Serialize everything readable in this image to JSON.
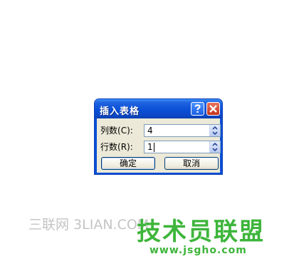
{
  "dialog": {
    "title": "插入表格",
    "help_button": "?",
    "columns_label": "列数",
    "columns_hotkey": "(C):",
    "columns_value": "4",
    "rows_label": "行数",
    "rows_hotkey": "(R):",
    "rows_value": "1",
    "ok_label": "确定",
    "cancel_label": "取消"
  },
  "watermark": {
    "left_text": "三联网 3LIAN.COM",
    "right_text": "技术员联盟",
    "url_text": "www.jsgho.com"
  },
  "colors": {
    "titlebar": "#0a4fd6",
    "dialog_bg": "#ece9d8",
    "watermark_green": "#3eb53b",
    "watermark_grey": "#c4c4c4"
  }
}
